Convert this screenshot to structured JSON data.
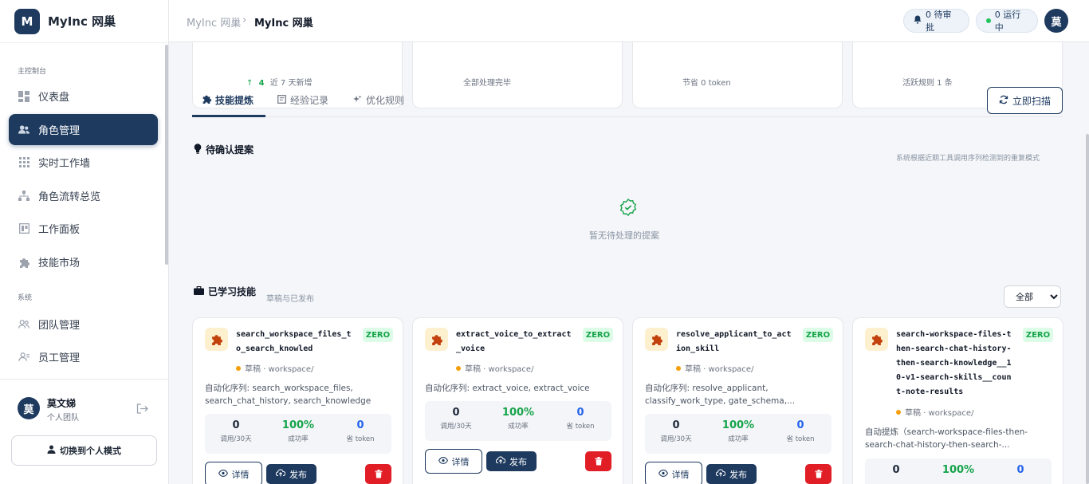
{
  "brand": {
    "logo_letter": "M",
    "name": "MyInc 网巢"
  },
  "sidebar": {
    "section_main": "主控制台",
    "section_system": "系统",
    "items": [
      {
        "label": "仪表盘",
        "icon": "dashboard-icon"
      },
      {
        "label": "角色管理",
        "icon": "users-icon",
        "active": true
      },
      {
        "label": "实时工作墙",
        "icon": "grid-icon"
      },
      {
        "label": "角色流转总览",
        "icon": "flow-icon"
      },
      {
        "label": "工作面板",
        "icon": "board-icon"
      },
      {
        "label": "技能市场",
        "icon": "puzzle-icon"
      }
    ],
    "system_items": [
      {
        "label": "团队管理",
        "icon": "team-icon"
      },
      {
        "label": "员工管理",
        "icon": "staff-icon"
      }
    ],
    "user": {
      "avatar": "莫",
      "name": "莫文娣",
      "team": "个人团队"
    },
    "switch_label": "切换到个人模式"
  },
  "header": {
    "crumb_root": "MyInc 网巢",
    "crumb_sep": "›",
    "crumb_current": "MyInc 网巢",
    "pending_label": "0 待审批",
    "running_label": "0 运行中",
    "avatar": "莫"
  },
  "stats": [
    {
      "sub_arrow": "↑",
      "sub_value": "4",
      "sub_text": "近 7 天新增"
    },
    {
      "sub_text": "全部处理完毕"
    },
    {
      "sub_text": "节省 0 token"
    },
    {
      "sub_text": "活跃规则 1 条"
    }
  ],
  "tabs": {
    "items": [
      {
        "label": "技能提炼"
      },
      {
        "label": "经验记录"
      },
      {
        "label": "优化规则"
      }
    ],
    "scan_label": "立即扫描"
  },
  "pending": {
    "title": "待确认提案",
    "hint": "系统根据近期工具调用序列检测到的重复模式",
    "empty_text": "暂无待处理的提案"
  },
  "learned": {
    "title": "已学习技能",
    "subtitle": "草稿与已发布",
    "filter_options": [
      "全部"
    ],
    "filter_selected": "全部"
  },
  "skills": [
    {
      "name": "search_workspace_files_to_search_knowled",
      "badge": "ZERO",
      "status": "草稿 · workspace/",
      "seq": "自动化序列: search_workspace_files, search_chat_history, search_knowledge",
      "calls": "0",
      "calls_cap": "调用/30天",
      "rate": "100%",
      "rate_cap": "成功率",
      "saved": "0",
      "saved_cap": "省 token",
      "detail": "详情",
      "publish": "发布"
    },
    {
      "name": "extract_voice_to_extract_voice",
      "badge": "ZERO",
      "status": "草稿 · workspace/",
      "seq": "自动化序列: extract_voice, extract_voice",
      "calls": "0",
      "calls_cap": "调用/30天",
      "rate": "100%",
      "rate_cap": "成功率",
      "saved": "0",
      "saved_cap": "省 token",
      "detail": "详情",
      "publish": "发布"
    },
    {
      "name": "resolve_applicant_to_action_skill",
      "badge": "ZERO",
      "status": "草稿 · workspace/",
      "seq": "自动化序列: resolve_applicant, classify_work_type, gate_schema,...",
      "calls": "0",
      "calls_cap": "调用/30天",
      "rate": "100%",
      "rate_cap": "成功率",
      "saved": "0",
      "saved_cap": "省 token",
      "detail": "详情",
      "publish": "发布"
    },
    {
      "name": "search-workspace-files-then-search-chat-history-then-search-knowledge__10-v1-search-skills__count-note-results",
      "badge": "ZERO",
      "status": "草稿 · workspace/",
      "seq": "自动提炼（search-workspace-files-then-search-chat-history-then-search-...",
      "calls": "0",
      "rate": "100%",
      "saved": "0"
    }
  ]
}
